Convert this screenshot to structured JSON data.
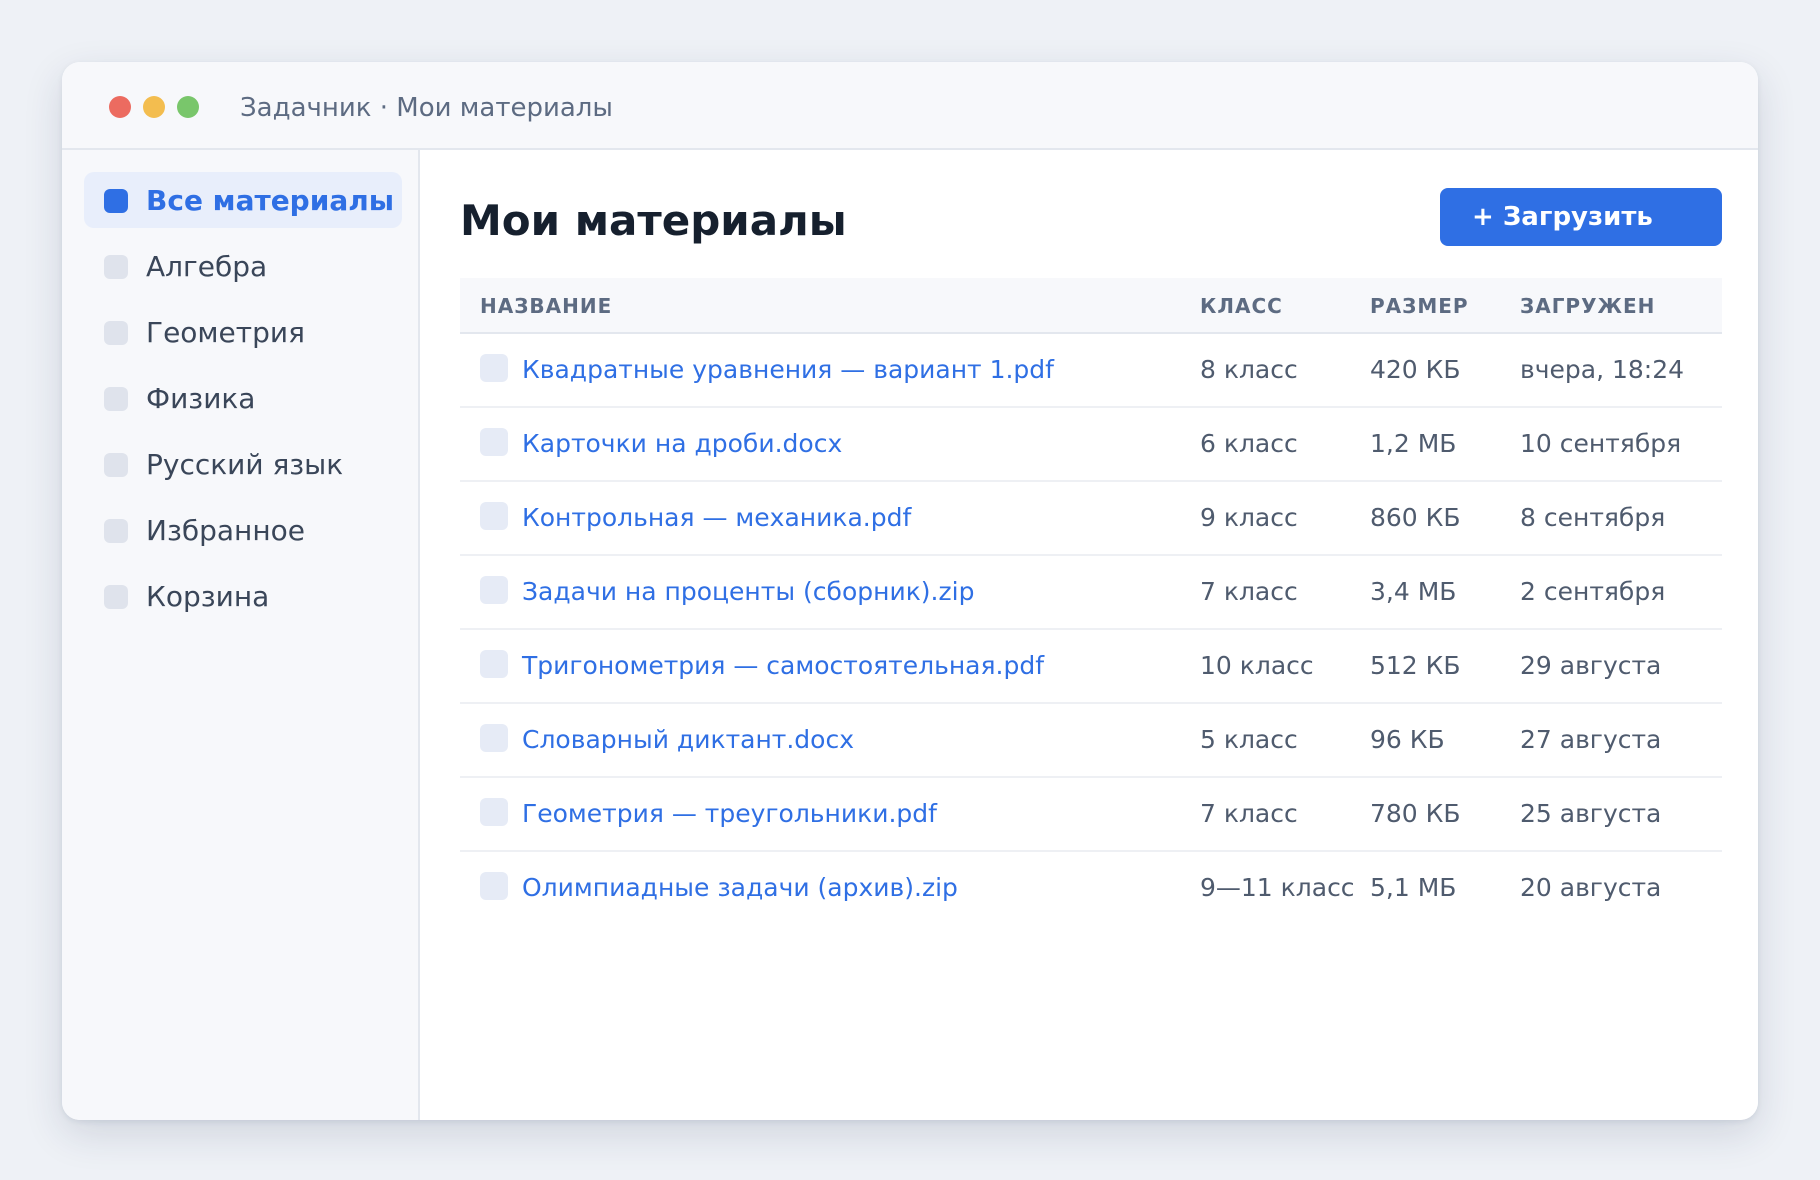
{
  "window": {
    "title": "Задачник · Мои материалы"
  },
  "sidebar": {
    "items": [
      {
        "label": "Все материалы",
        "active": true
      },
      {
        "label": "Алгебра",
        "active": false
      },
      {
        "label": "Геометрия",
        "active": false
      },
      {
        "label": "Физика",
        "active": false
      },
      {
        "label": "Русский язык",
        "active": false
      },
      {
        "label": "Избранное",
        "active": false
      },
      {
        "label": "Корзина",
        "active": false
      }
    ]
  },
  "main": {
    "title": "Мои материалы",
    "upload_label": "+ Загрузить"
  },
  "table": {
    "headers": {
      "name": "НАЗВАНИЕ",
      "grade": "КЛАСС",
      "size": "РАЗМЕР",
      "date": "ЗАГРУЖЕН"
    },
    "rows": [
      {
        "name": "Квадратные уравнения — вариант 1.pdf",
        "grade": "8 класс",
        "size": "420 КБ",
        "date": "вчера, 18:24"
      },
      {
        "name": "Карточки на дроби.docx",
        "grade": "6 класс",
        "size": "1,2 МБ",
        "date": "10 сентября"
      },
      {
        "name": "Контрольная — механика.pdf",
        "grade": "9 класс",
        "size": "860 КБ",
        "date": "8 сентября"
      },
      {
        "name": "Задачи на проценты (сборник).zip",
        "grade": "7 класс",
        "size": "3,4 МБ",
        "date": "2 сентября"
      },
      {
        "name": "Тригонометрия — самостоятельная.pdf",
        "grade": "10 класс",
        "size": "512 КБ",
        "date": "29 августа"
      },
      {
        "name": "Словарный диктант.docx",
        "grade": "5 класс",
        "size": "96 КБ",
        "date": "27 августа"
      },
      {
        "name": "Геометрия — треугольники.pdf",
        "grade": "7 класс",
        "size": "780 КБ",
        "date": "25 августа"
      },
      {
        "name": "Олимпиадные задачи (архив).zip",
        "grade": "9—11 класс",
        "size": "5,1 МБ",
        "date": "20 августа"
      }
    ]
  },
  "colors": {
    "accent": "#2f6fe4",
    "page_background": "#eef1f6",
    "sidebar_background": "#f7f8fb",
    "traffic_red": "#ec6b60",
    "traffic_yellow": "#f3bd4f",
    "traffic_green": "#79c66b"
  },
  "icons": {
    "window_close": "close-window-icon",
    "window_minimize": "minimize-window-icon",
    "window_zoom": "zoom-window-icon",
    "nav_item": "category-icon",
    "file": "file-icon"
  }
}
